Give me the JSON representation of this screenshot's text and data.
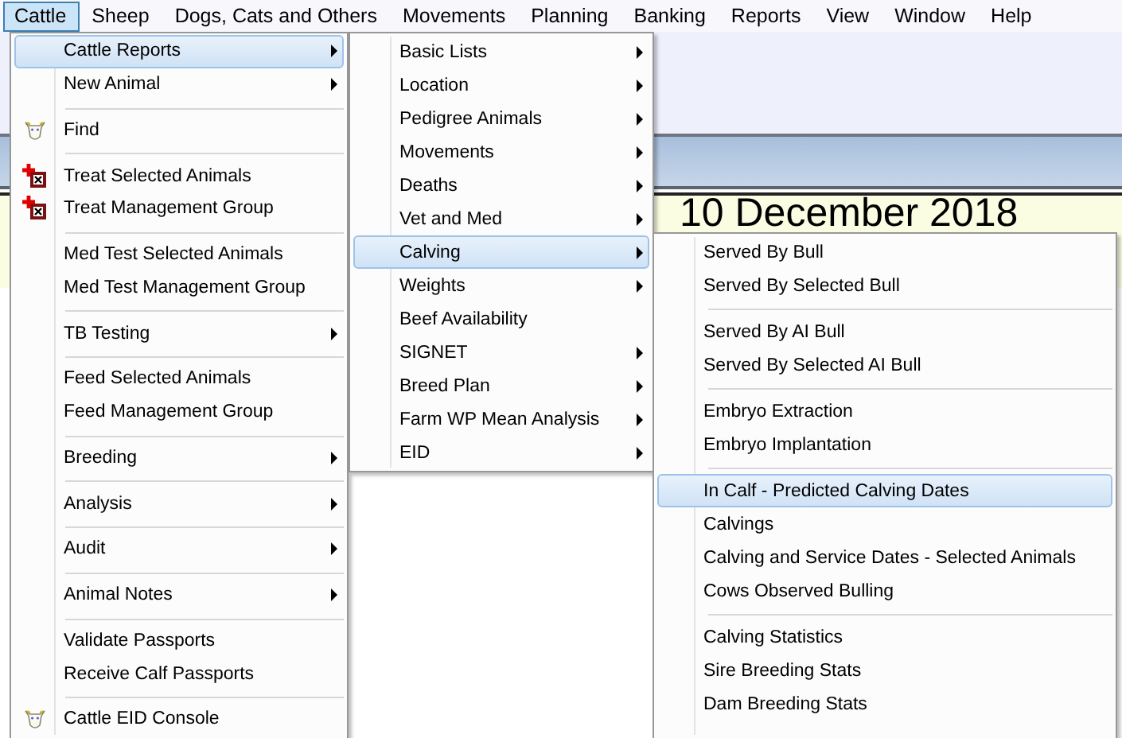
{
  "menubar": [
    {
      "label": "Cattle",
      "selected": true
    },
    {
      "label": "Sheep",
      "selected": false
    },
    {
      "label": "Dogs, Cats and Others",
      "selected": false
    },
    {
      "label": "Movements",
      "selected": false
    },
    {
      "label": "Planning",
      "selected": false
    },
    {
      "label": "Banking",
      "selected": false
    },
    {
      "label": "Reports",
      "selected": false
    },
    {
      "label": "View",
      "selected": false
    },
    {
      "label": "Window",
      "selected": false
    },
    {
      "label": "Help",
      "selected": false
    }
  ],
  "date_panel": {
    "date": "10 December 2018"
  },
  "menus": [
    {
      "items": [
        {
          "kind": "item",
          "label": "Cattle Reports",
          "submenu": true,
          "selected": true
        },
        {
          "kind": "item",
          "label": "New Animal",
          "submenu": true,
          "selected": false
        },
        {
          "kind": "separator"
        },
        {
          "kind": "animal",
          "label": "Find",
          "selected": false
        },
        {
          "kind": "separator"
        },
        {
          "kind": "treat",
          "label": "Treat Selected Animals",
          "selected": false
        },
        {
          "kind": "treat",
          "label": "Treat Management Group",
          "selected": false
        },
        {
          "kind": "separator"
        },
        {
          "kind": "item",
          "label": "Med Test Selected Animals",
          "selected": false
        },
        {
          "kind": "item",
          "label": "Med Test Management Group",
          "selected": false
        },
        {
          "kind": "separator"
        },
        {
          "kind": "item",
          "label": "TB Testing",
          "submenu": true,
          "selected": false
        },
        {
          "kind": "separator"
        },
        {
          "kind": "item",
          "label": "Feed Selected Animals",
          "selected": false
        },
        {
          "kind": "item",
          "label": "Feed Management Group",
          "selected": false
        },
        {
          "kind": "separator"
        },
        {
          "kind": "item",
          "label": "Breeding",
          "submenu": true,
          "selected": false
        },
        {
          "kind": "separator"
        },
        {
          "kind": "item",
          "label": "Analysis",
          "submenu": true,
          "selected": false
        },
        {
          "kind": "separator"
        },
        {
          "kind": "item",
          "label": "Audit",
          "submenu": true,
          "selected": false
        },
        {
          "kind": "separator"
        },
        {
          "kind": "item",
          "label": "Animal Notes",
          "submenu": true,
          "selected": false
        },
        {
          "kind": "separator"
        },
        {
          "kind": "item",
          "label": "Validate Passports",
          "selected": false
        },
        {
          "kind": "item",
          "label": "Receive Calf Passports",
          "selected": false
        },
        {
          "kind": "separator"
        },
        {
          "kind": "animal",
          "label": "Cattle EID Console",
          "selected": false
        }
      ]
    },
    {
      "items": [
        {
          "kind": "item",
          "label": "Basic Lists",
          "submenu": true,
          "selected": false
        },
        {
          "kind": "item",
          "label": "Location",
          "submenu": true,
          "selected": false
        },
        {
          "kind": "item",
          "label": "Pedigree Animals",
          "submenu": true,
          "selected": false
        },
        {
          "kind": "item",
          "label": "Movements",
          "submenu": true,
          "selected": false
        },
        {
          "kind": "item",
          "label": "Deaths",
          "submenu": true,
          "selected": false
        },
        {
          "kind": "item",
          "label": "Vet and Med",
          "submenu": true,
          "selected": false
        },
        {
          "kind": "item",
          "label": "Calving",
          "submenu": true,
          "selected": true
        },
        {
          "kind": "item",
          "label": "Weights",
          "submenu": true,
          "selected": false
        },
        {
          "kind": "item",
          "label": "Beef Availability",
          "selected": false
        },
        {
          "kind": "item",
          "label": "SIGNET",
          "submenu": true,
          "selected": false
        },
        {
          "kind": "item",
          "label": "Breed Plan",
          "submenu": true,
          "selected": false
        },
        {
          "kind": "item",
          "label": "Farm WP Mean Analysis",
          "submenu": true,
          "selected": false
        },
        {
          "kind": "item",
          "label": "EID",
          "submenu": true,
          "selected": false
        }
      ]
    },
    {
      "items": [
        {
          "kind": "item",
          "label": "Served By Bull",
          "selected": false
        },
        {
          "kind": "item",
          "label": "Served By Selected Bull",
          "selected": false
        },
        {
          "kind": "separator"
        },
        {
          "kind": "item",
          "label": "Served By AI Bull",
          "selected": false
        },
        {
          "kind": "item",
          "label": "Served By Selected AI Bull",
          "selected": false
        },
        {
          "kind": "separator"
        },
        {
          "kind": "item",
          "label": "Embryo Extraction",
          "selected": false
        },
        {
          "kind": "item",
          "label": "Embryo Implantation",
          "selected": false
        },
        {
          "kind": "separator"
        },
        {
          "kind": "item",
          "label": "In Calf - Predicted Calving Dates",
          "selected": true
        },
        {
          "kind": "item",
          "label": "Calvings",
          "selected": false
        },
        {
          "kind": "item",
          "label": "Calving and Service Dates - Selected Animals",
          "selected": false
        },
        {
          "kind": "item",
          "label": "Cows Observed Bulling",
          "selected": false
        },
        {
          "kind": "separator"
        },
        {
          "kind": "item",
          "label": "Calving Statistics",
          "selected": false
        },
        {
          "kind": "item",
          "label": "Sire Breeding Stats",
          "selected": false
        },
        {
          "kind": "item",
          "label": "Dam Breeding Stats",
          "selected": false
        }
      ]
    }
  ]
}
